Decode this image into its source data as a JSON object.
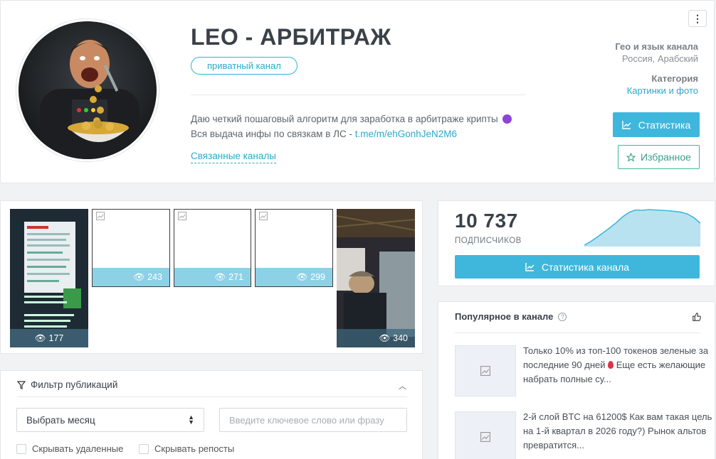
{
  "channel": {
    "title": "LEO - АРБИТРАЖ",
    "badge": "приватный канал",
    "description_line1": "Даю четкий пошаговый алгоритм для заработка в арбитраже крипты",
    "description_line2_prefix": "Вся выдача инфы по связкам в ЛС - ",
    "description_link": "t.me/m/ehGonhJeN2M6",
    "related_label": "Связанные каналы",
    "menu_icon": "⋮"
  },
  "meta": {
    "geo_label": "Гео и язык канала",
    "geo_value": "Россия, Арабский",
    "category_label": "Категория",
    "category_value": "Картинки и фото"
  },
  "buttons": {
    "statistics": "Статистика",
    "favorites": "Избранное",
    "channel_statistics": "Статистика канала"
  },
  "media": [
    {
      "views": "177",
      "type": "screenshot"
    },
    {
      "views": "243",
      "type": "broken"
    },
    {
      "views": "271",
      "type": "broken"
    },
    {
      "views": "299",
      "type": "broken"
    },
    {
      "views": "340",
      "type": "photo"
    }
  ],
  "subscribers": {
    "count": "10 737",
    "label": "ПОДПИСЧИКОВ"
  },
  "popular": {
    "title": "Популярное в канале",
    "items": [
      {
        "text_before_drop": "Только 10% из топ-100 токенов зеленые за последние 90 дней",
        "text_after_drop": "Еще есть желающие набрать полные су..."
      },
      {
        "text": "2-й слой BTC на 61200$ Как вам такая цель на 1-й квартал в 2026 году?) Рынок альтов превратится..."
      }
    ]
  },
  "filter": {
    "title": "Фильтр публикаций",
    "month_select": "Выбрать месяц",
    "search_placeholder": "Введите ключевое слово или фразу",
    "hide_deleted": "Скрывать удаленные",
    "hide_reposts": "Скрывать репосты"
  },
  "colors": {
    "accent": "#3fb7dc",
    "favorite": "#3fb79a",
    "views_bar": "#8dd1e6"
  },
  "spark_data": [
    0,
    10,
    22,
    35,
    48,
    62,
    78,
    90,
    96,
    95,
    97,
    96,
    95,
    94,
    92,
    90,
    85,
    75,
    60
  ]
}
